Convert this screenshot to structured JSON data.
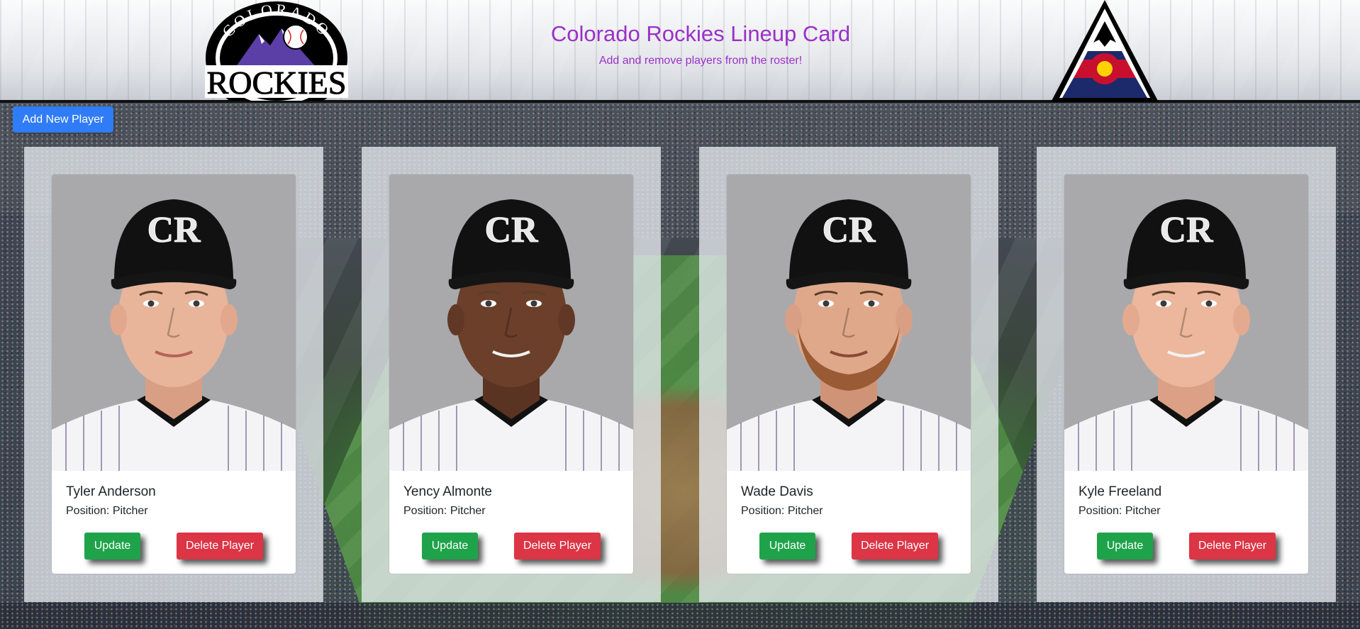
{
  "header": {
    "title": "Colorado Rockies Lineup Card",
    "subtitle": "Add and remove players from the roster!",
    "logo_left": "colorado-rockies-logo",
    "logo_left_text_top": "COLORADO",
    "logo_left_text_main": "ROCKIES",
    "logo_right": "colorado-flag-mountain-logo",
    "title_color": "#9b30c8"
  },
  "toolbar": {
    "add_label": "Add New Player",
    "add_color": "#2f7cf6"
  },
  "players": [
    {
      "name": "Tyler Anderson",
      "position": "Position: Pitcher",
      "update_label": "Update",
      "delete_label": "Delete Player",
      "cap_logo": "CR"
    },
    {
      "name": "Yency Almonte",
      "position": "Position: Pitcher",
      "update_label": "Update",
      "delete_label": "Delete Player",
      "cap_logo": "CR"
    },
    {
      "name": "Wade Davis",
      "position": "Position: Pitcher",
      "update_label": "Update",
      "delete_label": "Delete Player",
      "cap_logo": "CR"
    },
    {
      "name": "Kyle Freeland",
      "position": "Position: Pitcher",
      "update_label": "Update",
      "delete_label": "Delete Player",
      "cap_logo": "CR"
    }
  ],
  "colors": {
    "update": "#1fa34a",
    "delete": "#dc3545"
  }
}
